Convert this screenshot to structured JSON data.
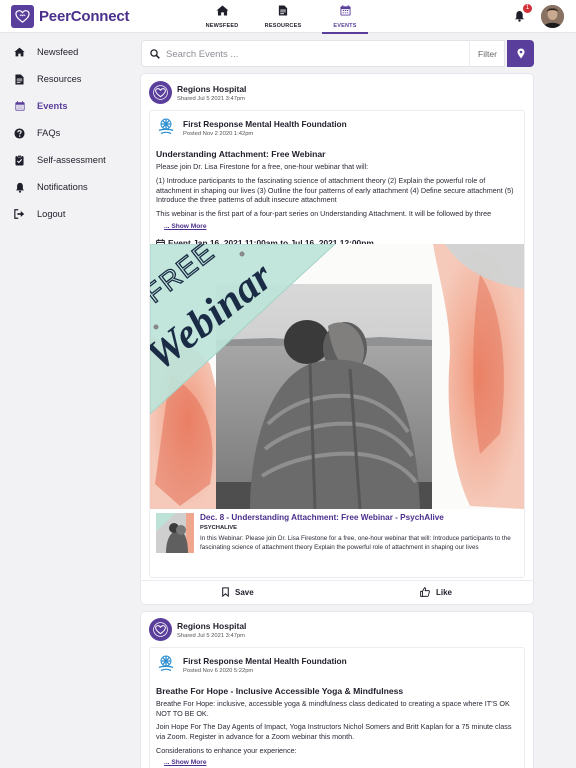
{
  "app": {
    "name": "PeerConnect",
    "brand_color": "#5a3e9b"
  },
  "topnav": {
    "tabs": [
      {
        "label": "NEWSFEED",
        "icon": "home-icon"
      },
      {
        "label": "RESOURCES",
        "icon": "document-icon"
      },
      {
        "label": "EVENTS",
        "icon": "calendar-icon",
        "active": true
      }
    ],
    "notification_count": "1"
  },
  "sidebar": {
    "items": [
      {
        "label": "Newsfeed",
        "icon": "home-icon"
      },
      {
        "label": "Resources",
        "icon": "document-icon"
      },
      {
        "label": "Events",
        "icon": "calendar-icon",
        "active": true
      },
      {
        "label": "FAQs",
        "icon": "question-icon"
      },
      {
        "label": "Self-assessment",
        "icon": "clipboard-check-icon"
      },
      {
        "label": "Notifications",
        "icon": "bell-icon"
      },
      {
        "label": "Logout",
        "icon": "logout-icon"
      }
    ]
  },
  "search": {
    "placeholder": "Search Events ...",
    "filter_label": "Filter"
  },
  "posts": [
    {
      "org": "Regions Hospital",
      "shared": "Shared Jul 5 2021 3:47pm",
      "author": "First Response Mental Health Foundation",
      "posted": "Posted Nov 2 2020 1:42pm",
      "title": "Understanding Attachment: Free Webinar",
      "paragraphs": [
        "Please join Dr. Lisa Firestone for a free, one-hour webinar that will:",
        "(1) Introduce participants to the fascinating science of attachment theory (2) Explain the powerful role of attachment in shaping our lives (3) Outline the four patterns of early attachment (4) Define secure attachment (5) Introduce the three patterns of adult insecure attachment",
        "This webinar is the first part of a four-part series on Understanding Attachment. It will be followed by three"
      ],
      "show_more": "... Show More",
      "event_time": "Event Jan 16, 2021 11:00am to Jul 16, 2021 12:00pm",
      "image_text": {
        "line1": "FREE",
        "line2": "Webinar"
      },
      "link": {
        "title": "Dec. 8 - Understanding Attachment: Free Webinar - PsychAlive",
        "site": "PSYCHALIVE",
        "description": "In this Webinar:  Please join Dr. Lisa Firestone for a free, one-hour webinar that will: Introduce participants to the fascinating science of attachment theory Explain the powerful role of attachment in shaping our lives"
      },
      "save_label": "Save",
      "like_label": "Like"
    },
    {
      "org": "Regions Hospital",
      "shared": "Shared Jul 5 2021 3:47pm",
      "author": "First Response Mental Health Foundation",
      "posted": "Posted Nov 6 2020 5:22pm",
      "title": "Breathe For Hope - Inclusive Accessible Yoga & Mindfulness",
      "paragraphs": [
        "Breathe For Hope: inclusive, accessible yoga & mindfulness class dedicated to creating a space where IT'S OK NOT TO BE OK.",
        "Join Hope For The Day Agents of Impact, Yoga Instructors Nichol Somers and Britt Kaplan for a 75 minute class via Zoom. Register in advance for a Zoom webinar this month.",
        "Considerations to enhance your experience:"
      ],
      "show_more": "... Show More"
    }
  ]
}
